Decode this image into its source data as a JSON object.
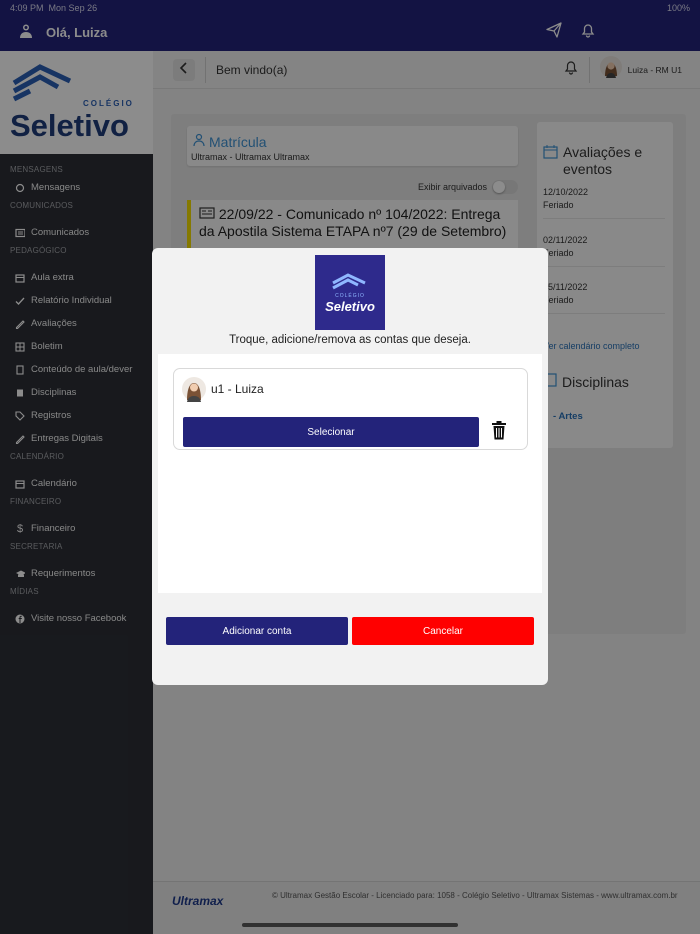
{
  "status": {
    "time": "4:09 PM",
    "date": "Mon Sep 26",
    "battery": "100%"
  },
  "topbar": {
    "greeting": "Olá, Luiza"
  },
  "sidebar": {
    "logo": {
      "small": "COLÉGIO",
      "big": "Seletivo"
    },
    "sections": {
      "mensagens": "MENSAGENS",
      "comunicados": "COMUNICADOS",
      "pedagogico": "PEDAGÓGICO",
      "calendario": "CALENDÁRIO",
      "financeiro": "FINANCEIRO",
      "secretaria": "SECRETARIA",
      "midias": "MÍDIAS"
    },
    "items": {
      "mensagens": "Mensagens",
      "comunicados": "Comunicados",
      "aula_extra": "Aula extra",
      "relatorio": "Relatório Individual",
      "avaliacoes": "Avaliações",
      "boletim": "Boletim",
      "conteudo": "Conteúdo de aula/dever",
      "disciplinas": "Disciplinas",
      "registros": "Registros",
      "entregas": "Entregas Digitais",
      "calendario": "Calendário",
      "financeiro": "Financeiro",
      "requerimentos": "Requerimentos",
      "facebook": "Visite nosso Facebook"
    }
  },
  "header": {
    "title": "Bem vindo(a)",
    "user": "Luiza - RM U1"
  },
  "main": {
    "matricula_title": "Matrícula",
    "matricula_sub": "Ultramax - Ultramax Ultramax",
    "exibir_arquivados": "Exibir arquivados",
    "comunicado": "22/09/22 - Comunicado nº 104/2022: Entrega da Apostila Sistema ETAPA nº7 (29 de Setembro)",
    "avaliacoes_title": "Avaliações e eventos",
    "events": [
      {
        "date": "12/10/2022",
        "label": "Feriado"
      },
      {
        "date": "02/11/2022",
        "label": "Feriado"
      },
      {
        "date": "15/11/2022",
        "label": "Feriado"
      }
    ],
    "ver_calendario": "Ver calendário completo",
    "disciplinas_title": "Disciplinas",
    "disciplina_item": "- Artes"
  },
  "footer": {
    "brand": "Ultramax",
    "text": "© Ultramax Gestão Escolar - Licenciado para: 1058 - Colégio Seletivo - Ultramax Sistemas - www.ultramax.com.br"
  },
  "modal": {
    "logo_word": "Seletivo",
    "logo_small": "COLÉGIO",
    "subtitle": "Troque, adicione/remova as contas que deseja.",
    "account_name": "u1 - Luiza",
    "select_label": "Selecionar",
    "add_label": "Adicionar conta",
    "cancel_label": "Cancelar"
  },
  "colors": {
    "primary": "#23237a",
    "cancel": "#ff0000",
    "link": "#2a72b8",
    "accent_bar": "#f2dd00"
  },
  "icons": [
    "user-group-icon",
    "send-icon",
    "bell-icon",
    "chevron-left-icon",
    "trash-icon",
    "facebook-icon"
  ]
}
